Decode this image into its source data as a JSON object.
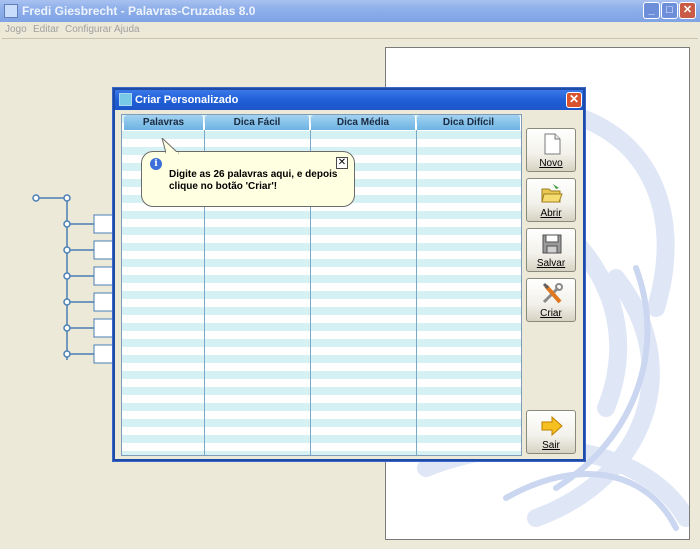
{
  "window": {
    "title": "Fredi Giesbrecht - Palavras-Cruzadas 8.0",
    "buttons": {
      "minimize": "_",
      "maximize": "□",
      "close": "✕"
    }
  },
  "menu": {
    "items": [
      "Jogo",
      "Editar",
      "Configurar",
      "Ajuda"
    ]
  },
  "dialog": {
    "title": "Criar Personalizado",
    "close": "✕",
    "columns": [
      "Palavras",
      "Dica Fácil",
      "Dica Média",
      "Dica Difícil"
    ],
    "tooltip": {
      "icon": "i",
      "close": "✕",
      "message": "Digite as 26 palavras aqui, e depois clique no botão 'Criar'!"
    },
    "buttons": [
      {
        "label": "Novo",
        "icon": "new-document-icon"
      },
      {
        "label": "Abrir",
        "icon": "open-folder-icon"
      },
      {
        "label": "Salvar",
        "icon": "save-disk-icon"
      },
      {
        "label": "Criar",
        "icon": "tools-icon"
      },
      {
        "label": "Sair",
        "icon": "exit-arrow-icon"
      }
    ]
  },
  "colors": {
    "title_bar": "#1f5fd8",
    "grid_stripe": "#d6f1f4",
    "header": "#6cb3e3",
    "tooltip_bg": "#ffffe1"
  }
}
